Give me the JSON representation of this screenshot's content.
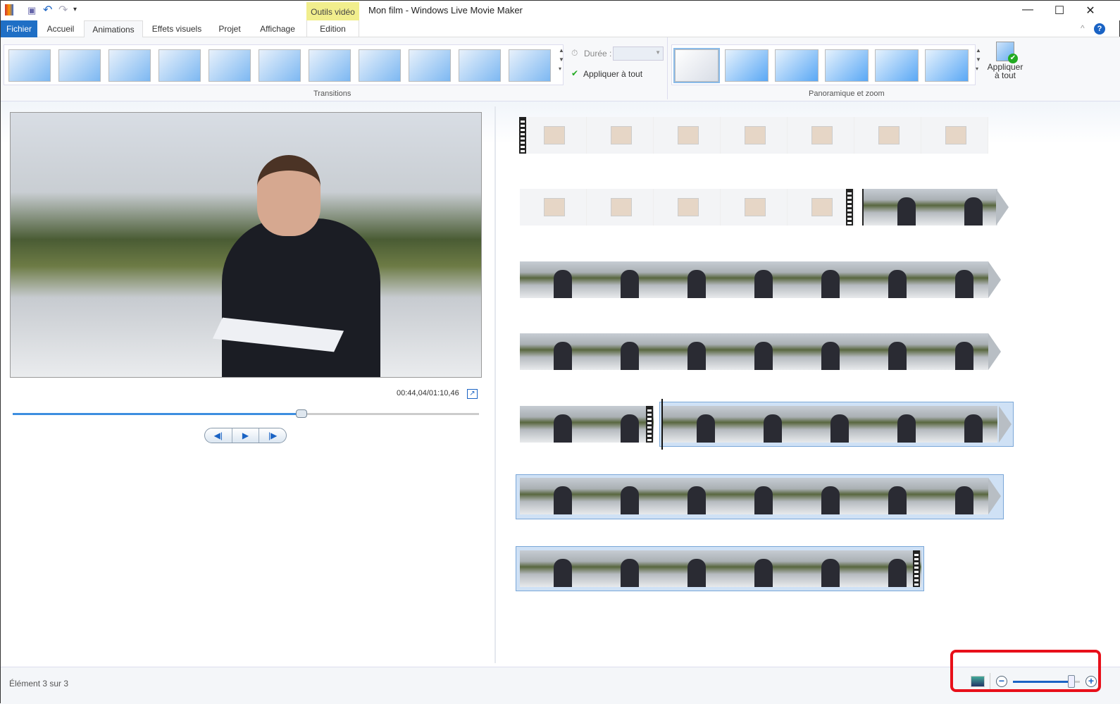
{
  "titlebar": {
    "title": "Mon film - Windows Live Movie Maker",
    "context_tab": "Outils vidéo",
    "minimize": "—",
    "maximize": "☐",
    "close": "✕",
    "help": "?"
  },
  "tabs": [
    {
      "label": "Fichier"
    },
    {
      "label": "Accueil"
    },
    {
      "label": "Animations",
      "active": true
    },
    {
      "label": "Effets visuels"
    },
    {
      "label": "Projet"
    },
    {
      "label": "Affichage"
    },
    {
      "label": "Edition"
    }
  ],
  "ribbon": {
    "transitions_label": "Transitions",
    "duration_label": "Durée :",
    "duration_value": "",
    "apply_all_transitions": "Appliquer à tout",
    "pan_zoom_label": "Panoramique et zoom",
    "apply_all_line1": "Appliquer",
    "apply_all_line2": "à tout"
  },
  "player": {
    "timecode": "00:44,04/01:10,46",
    "progress": 0.62,
    "prev": "◀|",
    "play": "▶",
    "next": "|▶"
  },
  "status": {
    "text": "Élément 3 sur 3",
    "zoom_level": 0.87
  },
  "colors": {
    "accent": "#1f6fc5",
    "context": "#f1ee8d",
    "highlight": "#e8101a"
  }
}
